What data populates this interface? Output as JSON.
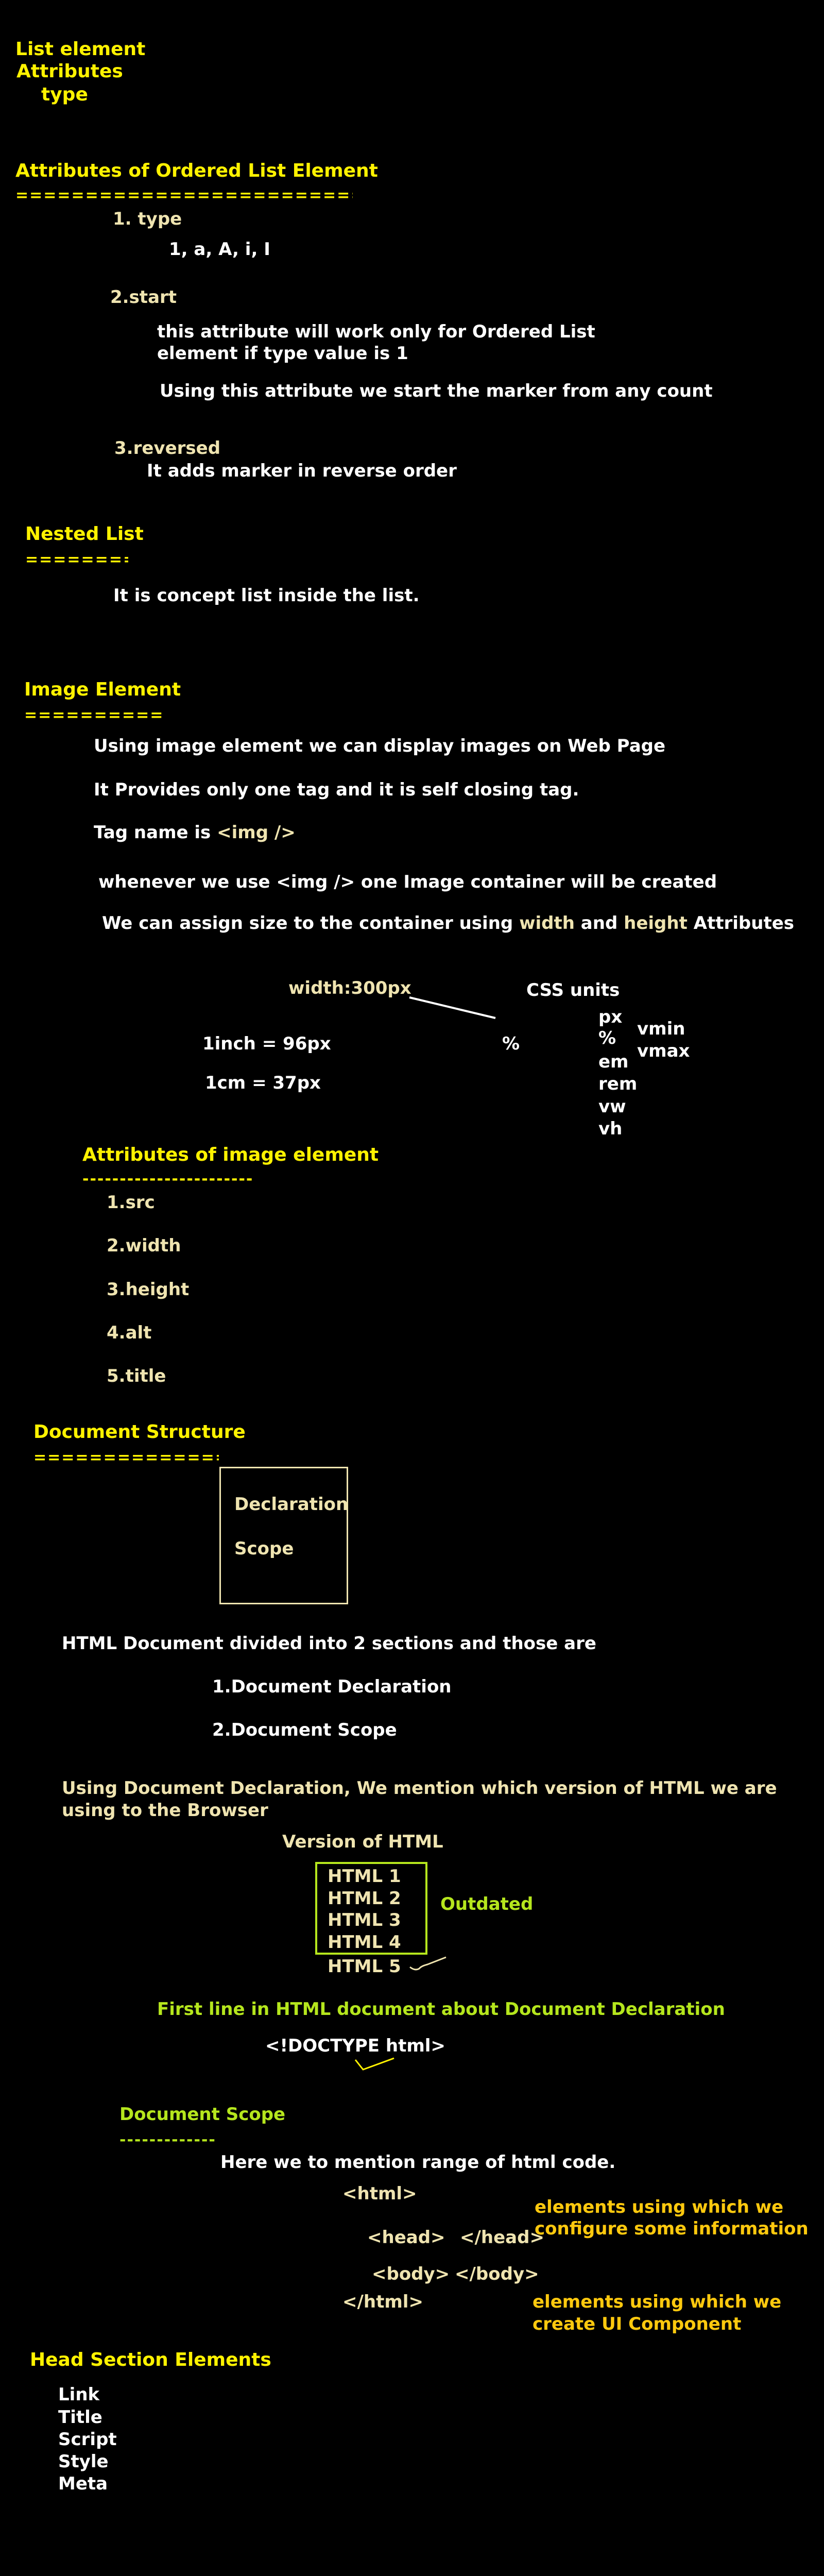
{
  "colors": {
    "heading": "#fff200",
    "beige": "#efe4b0",
    "green": "#b5e61d",
    "orange": "#ffc90e",
    "text": "#ffffff",
    "background": "#000000"
  },
  "intro": {
    "line1": "List element",
    "line2": "Attributes",
    "line3": "type"
  },
  "ordered": {
    "title": "Attributes of Ordered List Element",
    "rule": "==============================",
    "type_label": "1. type",
    "type_values": "1, a, A, i, I",
    "start_label": "2.start",
    "start_desc1": "this attribute will work only for Ordered List",
    "start_desc2": "element if type value is 1",
    "start_desc3": "Using this attribute we start the marker from any count",
    "reversed_label": "3.reversed",
    "reversed_desc": "It adds marker in reverse order"
  },
  "nested": {
    "title": "Nested List",
    "rule": "=========",
    "desc": "It is concept list inside the list."
  },
  "image": {
    "title": "Image Element",
    "rule": "============",
    "desc1": "Using image element we can display images on Web Page",
    "desc2": "It Provides only one tag and it is self closing tag.",
    "desc3_prefix": "Tag name is ",
    "desc3_tag": "<img />",
    "desc4": "whenever we use <img /> one Image container will be created",
    "desc5_a": "We can assign size to the container using ",
    "desc5_w": "width",
    "desc5_and": " and ",
    "desc5_h": "height",
    "desc5_b": " Attributes",
    "width_example": "width:300px",
    "css_units_title": "CSS units",
    "inch": "1inch = 96px",
    "cm": "1cm = 37px",
    "percent": "%",
    "units_col1": [
      "px",
      "%",
      "em",
      "rem",
      "vw",
      "vh"
    ],
    "units_col2": [
      "vmin",
      "vmax"
    ],
    "attrs_title": "Attributes of image element",
    "attrs_rule": "-----------------------",
    "attrs": [
      "1.src",
      "2.width",
      "3.height",
      "4.alt",
      "5.title"
    ]
  },
  "docstruct": {
    "title": "Document Structure",
    "rule": "================",
    "box_items": [
      "Declaration",
      "Scope"
    ],
    "desc": "HTML Document divided into 2 sections and those are",
    "sections": [
      "1.Document Declaration",
      "2.Document Scope"
    ],
    "decl_desc1": "Using Document Declaration, We mention which version of HTML we are",
    "decl_desc2": "using to the Browser",
    "version_title": "Version of HTML",
    "versions": [
      "HTML 1",
      "HTML 2",
      "HTML 3",
      "HTML 4",
      "HTML 5"
    ],
    "outdated": "Outdated",
    "first_line": "First line in HTML document about Document Declaration",
    "doctype": "<!DOCTYPE html>"
  },
  "scope": {
    "title": "Document Scope",
    "rule": "-------------",
    "desc": "Here we to mention range of html code.",
    "html_open": "<html>",
    "head_open": "<head>",
    "head_close": "</head>",
    "body_open": "<body>",
    "body_close": "</body>",
    "html_close": "</html>",
    "head_note1": "elements using which we",
    "head_note2": "configure some information",
    "body_note1": "elements using which we",
    "body_note2": "create UI Component"
  },
  "head_section": {
    "title": "Head Section Elements",
    "items": [
      "Link",
      "Title",
      "Script",
      "Style",
      "Meta"
    ]
  }
}
